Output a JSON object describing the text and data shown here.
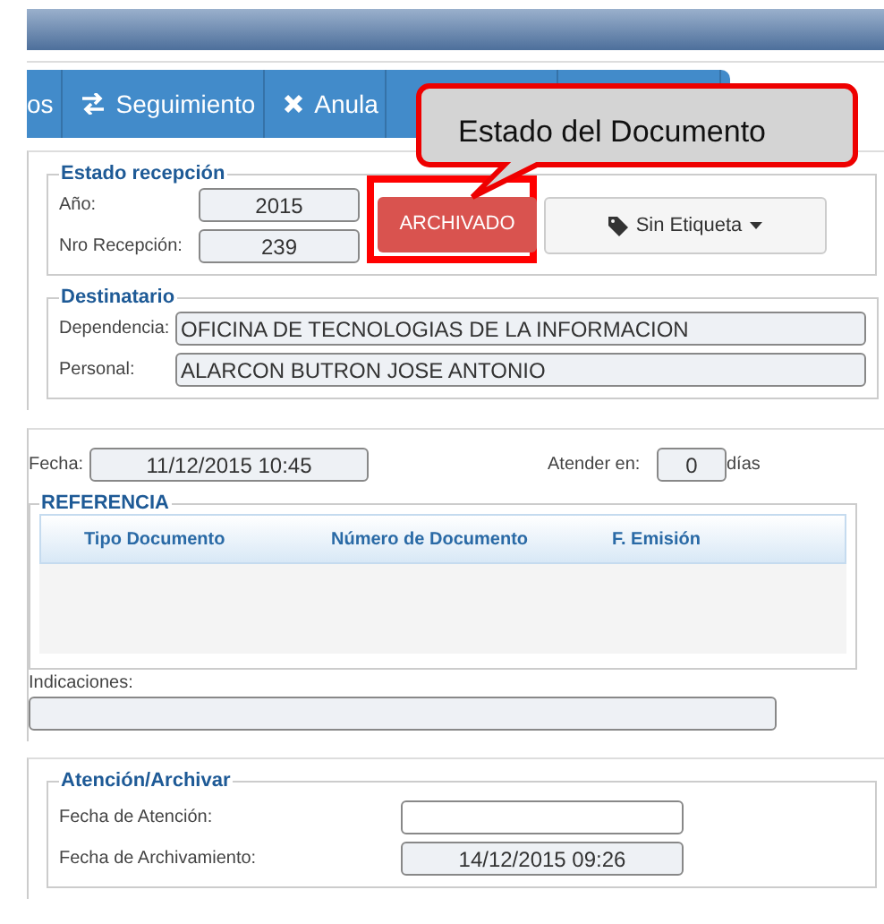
{
  "toolbar": {
    "tabs": [
      {
        "label": "os",
        "kind": "plain"
      },
      {
        "label": "Seguimiento",
        "kind": "exchange"
      },
      {
        "label": "Anula",
        "kind": "times"
      }
    ]
  },
  "callout": {
    "text": "Estado del Documento"
  },
  "estado": {
    "legend": "Estado recepción",
    "fields": [
      {
        "label": "Año:",
        "value": "2015"
      },
      {
        "label": "Nro Recepción:",
        "value": "239"
      }
    ],
    "status_button": "ARCHIVADO",
    "tag_button": "Sin Etiqueta"
  },
  "destinatario": {
    "legend": "Destinatario",
    "fields": [
      {
        "label": "Dependencia:",
        "value": "OFICINA DE TECNOLOGIAS DE LA INFORMACION"
      },
      {
        "label": "Personal:",
        "value": "ALARCON BUTRON JOSE ANTONIO"
      }
    ]
  },
  "fecha": {
    "label": "Fecha:",
    "value": "11/12/2015 10:45",
    "attend_label": "Atender en:",
    "attend_value": "0",
    "attend_unit": "días"
  },
  "referencia": {
    "legend": "REFERENCIA",
    "columns": [
      "Tipo Documento",
      "Número de Documento",
      "F. Emisión"
    ]
  },
  "indicaciones": {
    "label": "Indicaciones:"
  },
  "atencion": {
    "legend": "Atención/Archivar",
    "fields": [
      {
        "label": "Fecha de Atención:",
        "disabled": false
      },
      {
        "label": "Fecha de Archivamiento:",
        "value": "14/12/2015 09:26",
        "disabled": true
      }
    ]
  }
}
